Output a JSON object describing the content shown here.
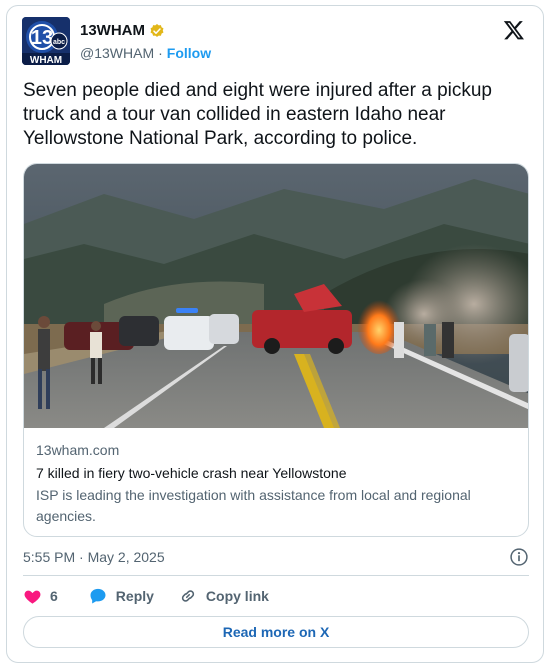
{
  "account": {
    "name": "13WHAM",
    "handle": "@13WHAM",
    "separator": "·",
    "follow_label": "Follow",
    "avatar_logo_top": "13",
    "avatar_logo_badge": "abc",
    "avatar_logo_bottom": "WHAM",
    "verified_color": "#e2b719"
  },
  "tweet": {
    "text": "Seven people died and eight were injured after a pickup truck and a tour van collided in eastern Idaho near Yellowstone National Park, according to police."
  },
  "link_card": {
    "domain": "13wham.com",
    "headline": "7 killed in fiery two-vehicle crash near Yellowstone",
    "description": "ISP is leading the investigation with assistance from local and regional agencies.",
    "image_subject": "crash-scene-photo"
  },
  "meta": {
    "timestamp": "5:55 PM · May 2, 2025"
  },
  "actions": {
    "like_count": "6",
    "reply_label": "Reply",
    "copy_link_label": "Copy link",
    "read_more_label": "Read more on X"
  },
  "colors": {
    "accent": "#1d9bf0",
    "heart": "#f91880",
    "text": "#0f1419",
    "muted": "#536471",
    "border": "#cfd9de"
  }
}
